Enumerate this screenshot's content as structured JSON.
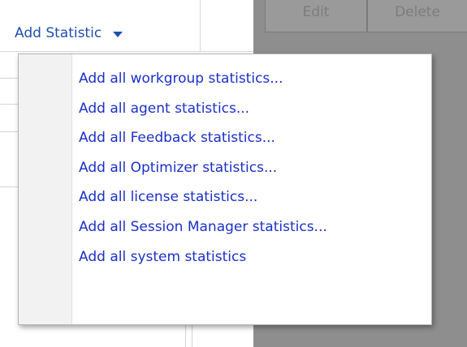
{
  "toolbar": {
    "add_statistic_label": "Add Statistic"
  },
  "background_buttons": {
    "edit_label": "Edit",
    "delete_label": "Delete"
  },
  "menu": {
    "items": [
      {
        "label": "Add all workgroup statistics..."
      },
      {
        "label": "Add all agent statistics..."
      },
      {
        "label": "Add all Feedback statistics..."
      },
      {
        "label": "Add all Optimizer statistics..."
      },
      {
        "label": "Add all license statistics..."
      },
      {
        "label": "Add all Session Manager statistics..."
      },
      {
        "label": "Add all system statistics"
      }
    ]
  },
  "colors": {
    "link_blue": "#1b30c8",
    "button_blue": "#1f4fb2",
    "overlay_gray": "#8e8e8e"
  }
}
